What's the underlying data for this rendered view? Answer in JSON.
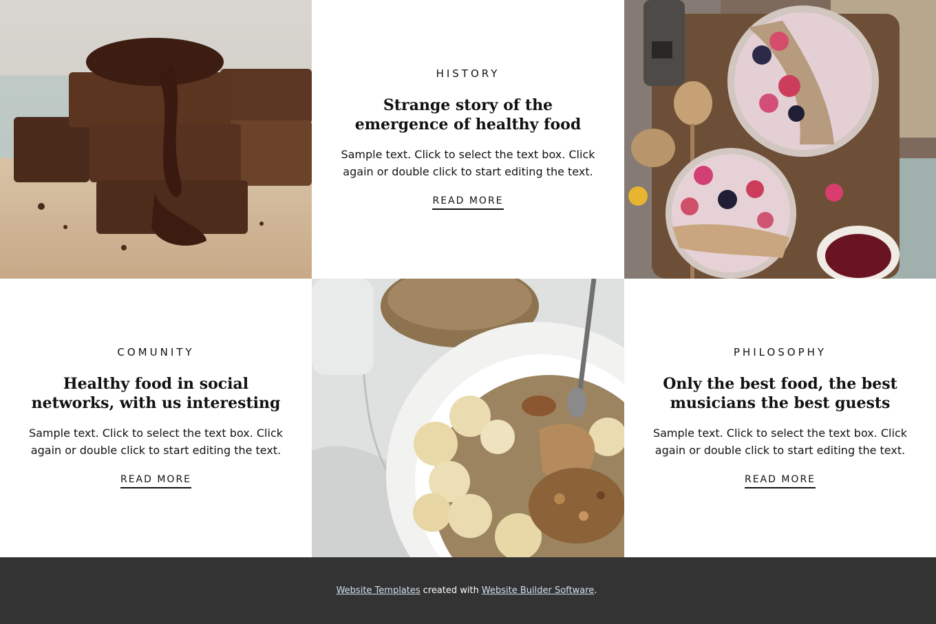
{
  "cards": [
    {
      "kicker": "HISTORY",
      "heading": "Strange story of the emergence of healthy food",
      "body": "Sample text. Click to select the text box. Click again or double click to start editing the text.",
      "link": "READ MORE"
    },
    {
      "kicker": "COMUNITY",
      "heading": "Healthy food in social networks, with us interesting",
      "body": "Sample text. Click to select the text box. Click again or double click to start editing the text.",
      "link": "READ MORE"
    },
    {
      "kicker": "PHILOSOPHY",
      "heading": "Only the best food, the best musicians the best guests",
      "body": "Sample text. Click to select the text box. Click again or double click to start editing the text.",
      "link": "READ MORE"
    }
  ],
  "images": {
    "brownies": "brownies-photo",
    "smoothie_bowls": "smoothie-bowls-photo",
    "oatmeal_bowl": "oatmeal-bowl-photo"
  },
  "footer": {
    "link1": "Website Templates",
    "middle": "created with",
    "link2": "Website Builder Software",
    "end": "."
  },
  "colors": {
    "footer_bg": "#333333",
    "footer_link": "#cfe0f2",
    "text": "#111111"
  }
}
